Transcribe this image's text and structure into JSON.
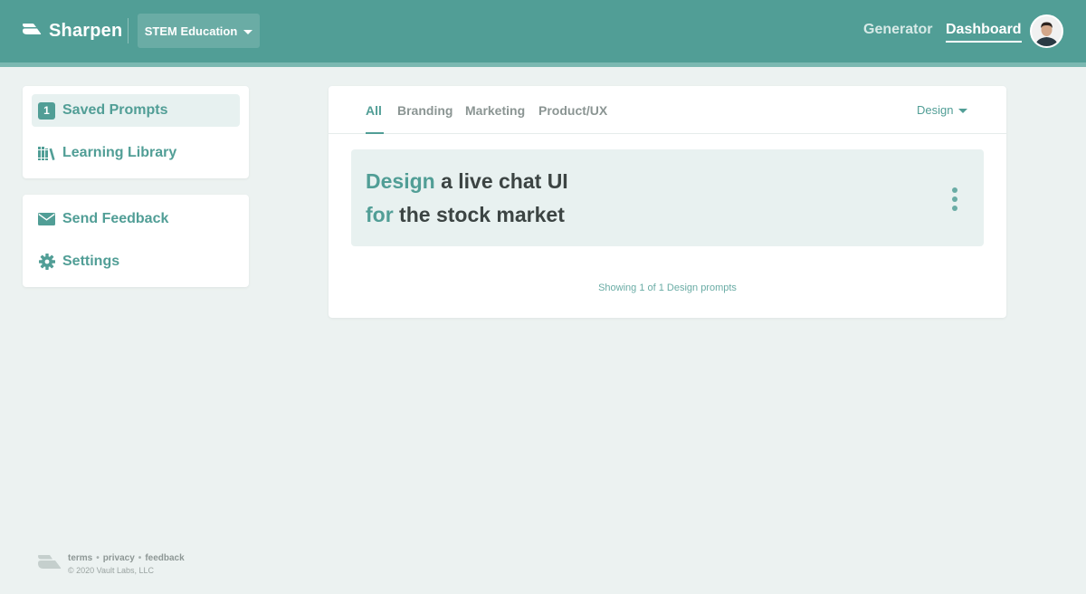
{
  "header": {
    "brand_name": "Sharpen",
    "org_select": "STEM Education",
    "nav": {
      "generator": "Generator",
      "dashboard": "Dashboard"
    }
  },
  "sidebar": {
    "primary": [
      {
        "badge": "1",
        "label": "Saved Prompts",
        "active": true
      },
      {
        "label": "Learning Library",
        "icon": "books-icon"
      }
    ],
    "secondary": [
      {
        "label": "Send Feedback",
        "icon": "envelope-icon"
      },
      {
        "label": "Settings",
        "icon": "gear-icon"
      }
    ]
  },
  "main": {
    "tabs": [
      "All",
      "Branding",
      "Marketing",
      "Product/UX"
    ],
    "active_tab": "All",
    "filter": "Design",
    "prompt": {
      "line1_keyword": "Design",
      "line1_text": " a live chat UI",
      "line2_keyword": "for",
      "line2_text": " the stock market"
    },
    "showing": "Showing 1 of 1 Design prompts"
  },
  "footer": {
    "links": [
      "terms",
      "privacy",
      "feedback"
    ],
    "separator": "•",
    "copyright": "© 2020 Vault Labs, LLC"
  },
  "colors": {
    "accent": "#519e96",
    "background": "#ecf2f1",
    "prompt_bg": "#e8f1f0"
  }
}
